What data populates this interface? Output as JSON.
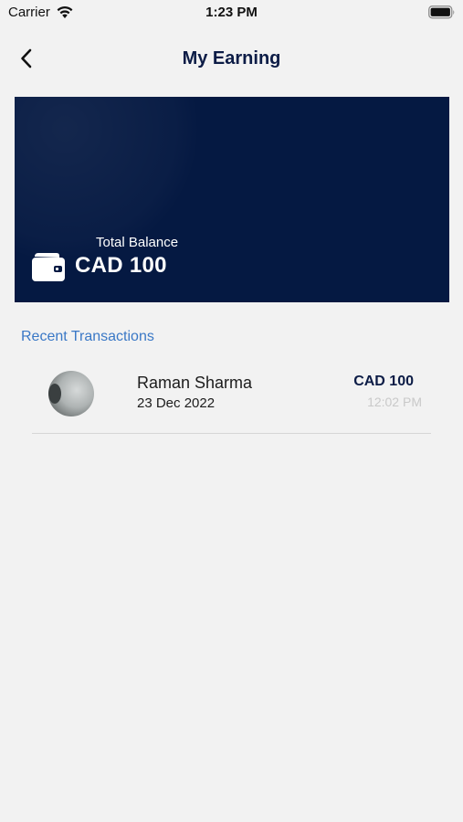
{
  "status_bar": {
    "carrier": "Carrier",
    "time": "1:23 PM",
    "icons": [
      "wifi-icon",
      "battery-icon"
    ]
  },
  "nav": {
    "back_icon": "chevron-left-icon",
    "title": "My Earning"
  },
  "balance_card": {
    "label": "Total Balance",
    "amount": "CAD 100",
    "icon": "wallet-icon",
    "background_color": "#051942"
  },
  "transactions": {
    "section_title": "Recent Transactions",
    "items": [
      {
        "name": "Raman Sharma",
        "date": "23 Dec 2022",
        "amount": "CAD 100",
        "time": "12:02 PM"
      }
    ]
  },
  "colors": {
    "accent": "#0c1c46",
    "link": "#3a78c6",
    "background": "#f2f2f2"
  }
}
